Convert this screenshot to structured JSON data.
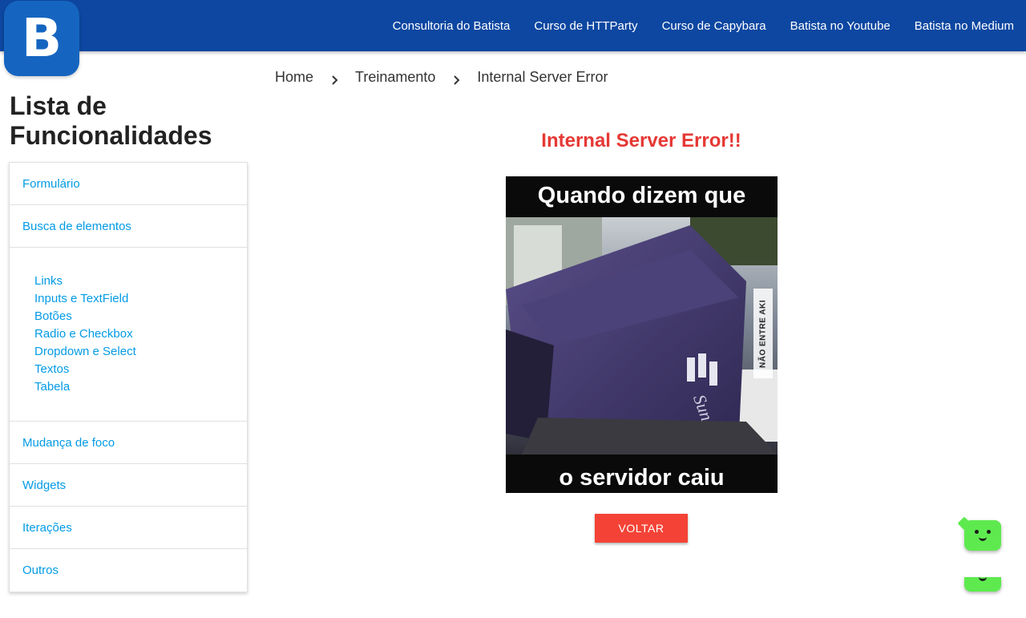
{
  "header": {
    "logo_letter": "B",
    "nav": [
      "Consultoria do Batista",
      "Curso de HTTParty",
      "Curso de Capybara",
      "Batista no Youtube",
      "Batista no Medium"
    ],
    "brand_color": "#0d47a1"
  },
  "breadcrumb": {
    "items": [
      "Home",
      "Treinamento",
      "Internal Server Error"
    ],
    "separator_icon": "chevron-right-icon"
  },
  "sidebar": {
    "title": "Lista de Funcionalidades",
    "items": [
      "Formulário",
      "Busca de elementos"
    ],
    "subitems": [
      "Links",
      "Inputs e TextField",
      "Botões",
      "Radio e Checkbox",
      "Dropdown e Select",
      "Textos",
      "Tabela"
    ],
    "items_after": [
      "Mudança de foco",
      "Widgets",
      "Iterações",
      "Outros"
    ],
    "link_color": "#039be5"
  },
  "main": {
    "error_title": "Internal Server Error!!",
    "meme": {
      "caption_top": "Quando dizem que",
      "caption_bottom": "o servidor caiu",
      "watermark": "NÃO ENTRE AKI"
    },
    "back_button": "VOLTAR",
    "error_color": "#e53935",
    "button_color": "#f44336"
  },
  "chat_widget": {
    "icon": "chatbot-face-icon",
    "color": "#5eea4f"
  }
}
